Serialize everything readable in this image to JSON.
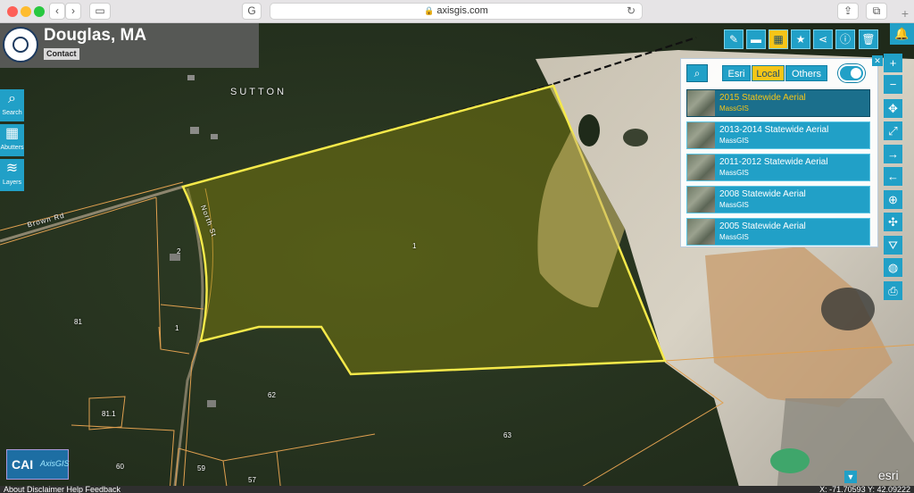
{
  "browser": {
    "url": "axisgis.com",
    "lock_icon": "lock-icon",
    "colors": {
      "close": "#fe5f57",
      "minimize": "#febc2e",
      "zoom": "#28c840"
    }
  },
  "header": {
    "town": "Douglas, MA",
    "contact_label": "Contact"
  },
  "left_tools": [
    {
      "label": "Search",
      "icon": "search-icon"
    },
    {
      "label": "Abutters",
      "icon": "grid-icon"
    },
    {
      "label": "Layers",
      "icon": "layers-icon"
    }
  ],
  "top_toolbar": [
    {
      "icon": "pencil-icon",
      "active": false
    },
    {
      "icon": "ruler-icon",
      "active": false
    },
    {
      "icon": "basemap-grid-icon",
      "active": true
    },
    {
      "icon": "star-icon",
      "active": false
    },
    {
      "icon": "share-icon",
      "active": false
    },
    {
      "icon": "info-icon",
      "active": false
    },
    {
      "icon": "trash-icon",
      "active": false
    }
  ],
  "basemap_panel": {
    "tabs": [
      "Esri",
      "Local",
      "Others"
    ],
    "active_tab": "Local",
    "items": [
      {
        "title": "2015 Statewide Aerial",
        "source": "MassGIS",
        "selected": true
      },
      {
        "title": "2013-2014 Statewide Aerial",
        "source": "MassGIS",
        "selected": false
      },
      {
        "title": "2011-2012 Statewide Aerial",
        "source": "MassGIS",
        "selected": false
      },
      {
        "title": "2008 Statewide Aerial",
        "source": "MassGIS",
        "selected": false
      },
      {
        "title": "2005 Statewide Aerial",
        "source": "MassGIS",
        "selected": false
      }
    ]
  },
  "right_tools": [
    "zoom-in-icon",
    "zoom-out-icon",
    "full-extent-icon",
    "expand-icon",
    "forward-icon",
    "back-icon",
    "zoom-rect-icon",
    "pan-icon",
    "road-icon",
    "globe-icon",
    "print-icon"
  ],
  "map_labels": {
    "sutton": "SUTTON",
    "brown_rd": "Brown Rd",
    "north_st": "North St",
    "parcels": [
      "1",
      "2",
      "1",
      "81",
      "81.1",
      "62",
      "63",
      "60",
      "59",
      "57"
    ]
  },
  "footer": {
    "links": "About   Disclaimer   Help   Feedback",
    "coords": "X: -71.70593  Y: 42.09222",
    "brand": "CAI",
    "brand_sub": "AxisGIS",
    "esri": "esri"
  },
  "colors": {
    "accent": "#21a0c7",
    "highlight": "#f5c518",
    "parcel_outline": "#f5e94a",
    "parcel_lines": "#e0a050"
  }
}
